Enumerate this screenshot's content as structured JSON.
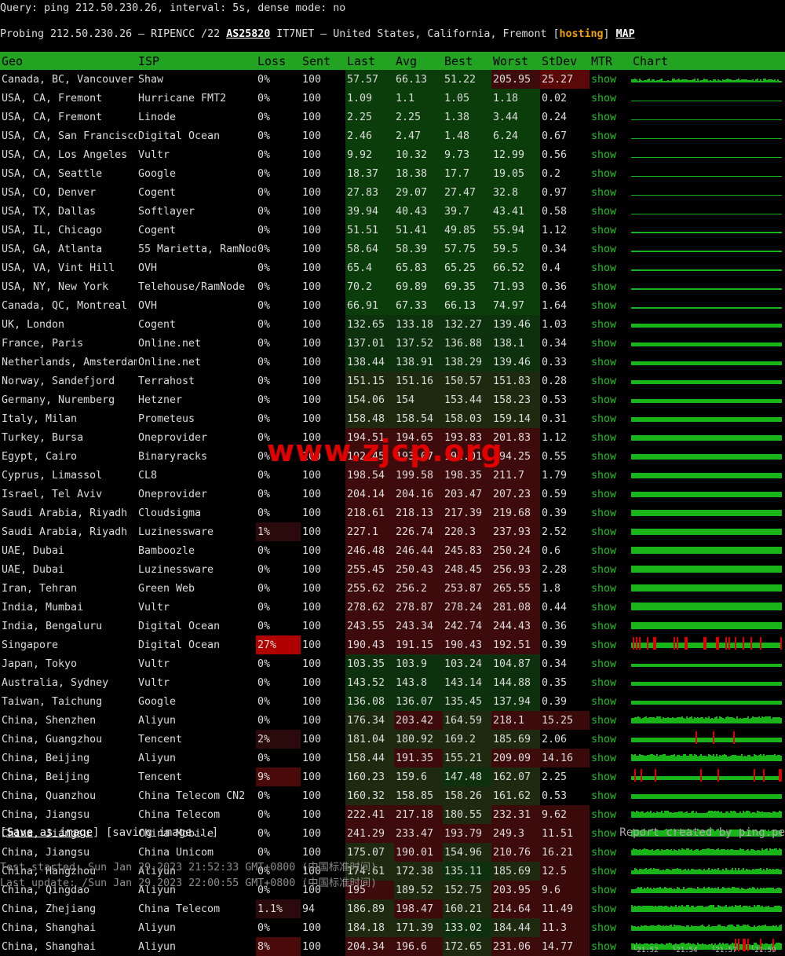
{
  "header": {
    "query": "Query: ping 212.50.230.26, interval: 5s, dense mode: no",
    "probe_prefix": "Probing 212.50.230.26 — RIPENCC /22 ",
    "asn": "AS25820",
    "probe_mid": " IT7NET — United States, California, Fremont [",
    "hosting": "hosting",
    "probe_close": "] ",
    "map": "MAP"
  },
  "columns": [
    "Geo",
    "ISP",
    "Loss",
    "Sent",
    "Last",
    "Avg",
    "Best",
    "Worst",
    "StDev",
    "MTR",
    "Chart"
  ],
  "mtr_label": "show",
  "colors": {
    "header_bg": "#22a322",
    "latency_low": "#0b3d0b",
    "latency_high": "#3d0b0b",
    "loss_high": "#b00000",
    "chart_bar": "#18b418",
    "chart_loss": "#e00000"
  },
  "rows": [
    [
      "Canada, BC, Vancouver",
      "Shaw",
      "0%",
      "100",
      "57.57",
      "66.13",
      "51.22",
      "205.95",
      "25.27"
    ],
    [
      "USA, CA, Fremont",
      "Hurricane FMT2",
      "0%",
      "100",
      "1.09",
      "1.1",
      "1.05",
      "1.18",
      "0.02"
    ],
    [
      "USA, CA, Fremont",
      "Linode",
      "0%",
      "100",
      "2.25",
      "2.25",
      "1.38",
      "3.44",
      "0.24"
    ],
    [
      "USA, CA, San Francisco",
      "Digital Ocean",
      "0%",
      "100",
      "2.46",
      "2.47",
      "1.48",
      "6.24",
      "0.67"
    ],
    [
      "USA, CA, Los Angeles",
      "Vultr",
      "0%",
      "100",
      "9.92",
      "10.32",
      "9.73",
      "12.99",
      "0.56"
    ],
    [
      "USA, CA, Seattle",
      "Google",
      "0%",
      "100",
      "18.37",
      "18.38",
      "17.7",
      "19.05",
      "0.2"
    ],
    [
      "USA, CO, Denver",
      "Cogent",
      "0%",
      "100",
      "27.83",
      "29.07",
      "27.47",
      "32.8",
      "0.97"
    ],
    [
      "USA, TX, Dallas",
      "Softlayer",
      "0%",
      "100",
      "39.94",
      "40.43",
      "39.7",
      "43.41",
      "0.58"
    ],
    [
      "USA, IL, Chicago",
      "Cogent",
      "0%",
      "100",
      "51.51",
      "51.41",
      "49.85",
      "55.94",
      "1.12"
    ],
    [
      "USA, GA, Atlanta",
      "55 Marietta, RamNode",
      "0%",
      "100",
      "58.64",
      "58.39",
      "57.75",
      "59.5",
      "0.34"
    ],
    [
      "USA, VA, Vint Hill",
      "OVH",
      "0%",
      "100",
      "65.4",
      "65.83",
      "65.25",
      "66.52",
      "0.4"
    ],
    [
      "USA, NY, New York",
      "Telehouse/RamNode",
      "0%",
      "100",
      "70.2",
      "69.89",
      "69.35",
      "71.93",
      "0.36"
    ],
    [
      "Canada, QC, Montreal",
      "OVH",
      "0%",
      "100",
      "66.91",
      "67.33",
      "66.13",
      "74.97",
      "1.64"
    ],
    [
      "UK, London",
      "Cogent",
      "0%",
      "100",
      "132.65",
      "133.18",
      "132.27",
      "139.46",
      "1.03"
    ],
    [
      "France, Paris",
      "Online.net",
      "0%",
      "100",
      "137.01",
      "137.52",
      "136.88",
      "138.1",
      "0.34"
    ],
    [
      "Netherlands, Amsterdam",
      "Online.net",
      "0%",
      "100",
      "138.44",
      "138.91",
      "138.29",
      "139.46",
      "0.33"
    ],
    [
      "Norway, Sandefjord",
      "Terrahost",
      "0%",
      "100",
      "151.15",
      "151.16",
      "150.57",
      "151.83",
      "0.28"
    ],
    [
      "Germany, Nuremberg",
      "Hetzner",
      "0%",
      "100",
      "154.06",
      "154",
      "153.44",
      "158.23",
      "0.53"
    ],
    [
      "Italy, Milan",
      "Prometeus",
      "0%",
      "100",
      "158.48",
      "158.54",
      "158.03",
      "159.14",
      "0.31"
    ],
    [
      "Turkey, Bursa",
      "Oneprovider",
      "0%",
      "100",
      "194.51",
      "194.65",
      "193.83",
      "201.83",
      "1.12"
    ],
    [
      "Egypt, Cairo",
      "Binaryracks",
      "0%",
      "100",
      "192.45",
      "193.07",
      "192.01",
      "194.25",
      "0.55"
    ],
    [
      "Cyprus, Limassol",
      "CL8",
      "0%",
      "100",
      "198.54",
      "199.58",
      "198.35",
      "211.7",
      "1.79"
    ],
    [
      "Israel, Tel Aviv",
      "Oneprovider",
      "0%",
      "100",
      "204.14",
      "204.16",
      "203.47",
      "207.23",
      "0.59"
    ],
    [
      "Saudi Arabia, Riyadh",
      "Cloudsigma",
      "0%",
      "100",
      "218.61",
      "218.13",
      "217.39",
      "219.68",
      "0.39"
    ],
    [
      "Saudi Arabia, Riyadh",
      "Luzinessware",
      "1%",
      "100",
      "227.1",
      "226.74",
      "220.3",
      "237.93",
      "2.52"
    ],
    [
      "UAE, Dubai",
      "Bamboozle",
      "0%",
      "100",
      "246.48",
      "246.44",
      "245.83",
      "250.24",
      "0.6"
    ],
    [
      "UAE, Dubai",
      "Luzinessware",
      "0%",
      "100",
      "255.45",
      "250.43",
      "248.45",
      "256.93",
      "2.28"
    ],
    [
      "Iran, Tehran",
      "Green Web",
      "0%",
      "100",
      "255.62",
      "256.2",
      "253.87",
      "265.55",
      "1.8"
    ],
    [
      "India, Mumbai",
      "Vultr",
      "0%",
      "100",
      "278.62",
      "278.87",
      "278.24",
      "281.08",
      "0.44"
    ],
    [
      "India, Bengaluru",
      "Digital Ocean",
      "0%",
      "100",
      "243.55",
      "243.34",
      "242.74",
      "244.43",
      "0.36"
    ],
    [
      "Singapore",
      "Digital Ocean",
      "27%",
      "100",
      "190.43",
      "191.15",
      "190.43",
      "192.51",
      "0.39"
    ],
    [
      "Japan, Tokyo",
      "Vultr",
      "0%",
      "100",
      "103.35",
      "103.9",
      "103.24",
      "104.87",
      "0.34"
    ],
    [
      "Australia, Sydney",
      "Vultr",
      "0%",
      "100",
      "143.52",
      "143.8",
      "143.14",
      "144.88",
      "0.35"
    ],
    [
      "Taiwan, Taichung",
      "Google",
      "0%",
      "100",
      "136.08",
      "136.07",
      "135.45",
      "137.94",
      "0.39"
    ],
    [
      "China, Shenzhen",
      "Aliyun",
      "0%",
      "100",
      "176.34",
      "203.42",
      "164.59",
      "218.1",
      "15.25"
    ],
    [
      "China, Guangzhou",
      "Tencent",
      "2%",
      "100",
      "181.04",
      "180.92",
      "169.2",
      "185.69",
      "2.06"
    ],
    [
      "China, Beijing",
      "Aliyun",
      "0%",
      "100",
      "158.44",
      "191.35",
      "155.21",
      "209.09",
      "14.16"
    ],
    [
      "China, Beijing",
      "Tencent",
      "9%",
      "100",
      "160.23",
      "159.6",
      "147.48",
      "162.07",
      "2.25"
    ],
    [
      "China, Quanzhou",
      "China Telecom CN2",
      "0%",
      "100",
      "160.32",
      "158.85",
      "158.26",
      "161.62",
      "0.53"
    ],
    [
      "China, Jiangsu",
      "China Telecom",
      "0%",
      "100",
      "222.41",
      "217.18",
      "180.55",
      "232.31",
      "9.62"
    ],
    [
      "China, Jiangsu",
      "China Mobile",
      "0%",
      "100",
      "241.29",
      "233.47",
      "193.79",
      "249.3",
      "11.51"
    ],
    [
      "China, Jiangsu",
      "China Unicom",
      "0%",
      "100",
      "175.07",
      "190.01",
      "154.96",
      "210.76",
      "16.21"
    ],
    [
      "China, Hangzhou",
      "Aliyun",
      "0%",
      "100",
      "174.61",
      "172.38",
      "135.11",
      "185.69",
      "12.5"
    ],
    [
      "China, Qingdao",
      "Aliyun",
      "0%",
      "100",
      "195",
      "189.52",
      "152.75",
      "203.95",
      "9.6"
    ],
    [
      "China, Zhejiang",
      "China Telecom",
      "1.1%",
      "94",
      "186.89",
      "198.47",
      "160.21",
      "214.64",
      "11.49"
    ],
    [
      "China, Shanghai",
      "Aliyun",
      "0%",
      "100",
      "184.18",
      "171.39",
      "133.02",
      "184.44",
      "11.3"
    ],
    [
      "China, Shanghai",
      "Aliyun",
      "8%",
      "100",
      "204.34",
      "196.6",
      "172.65",
      "231.06",
      "14.77"
    ]
  ],
  "chart_ticks": [
    "└21:52",
    "└21:54",
    "└21:57",
    "└21:59"
  ],
  "footer": {
    "save_link": "Save as image",
    "save_open": "[",
    "save_status": "] [saving image...]",
    "credit": "Report created by ping.pe",
    "test_started": "Test started: Sun Jan 29 2023 21:52:33 GMT+0800 (中国标准时间)",
    "last_update": "Last update: /Sun Jan 29 2023 22:00:55 GMT+0800 (中国标准时间)"
  },
  "watermark": "www.zjcp.org"
}
